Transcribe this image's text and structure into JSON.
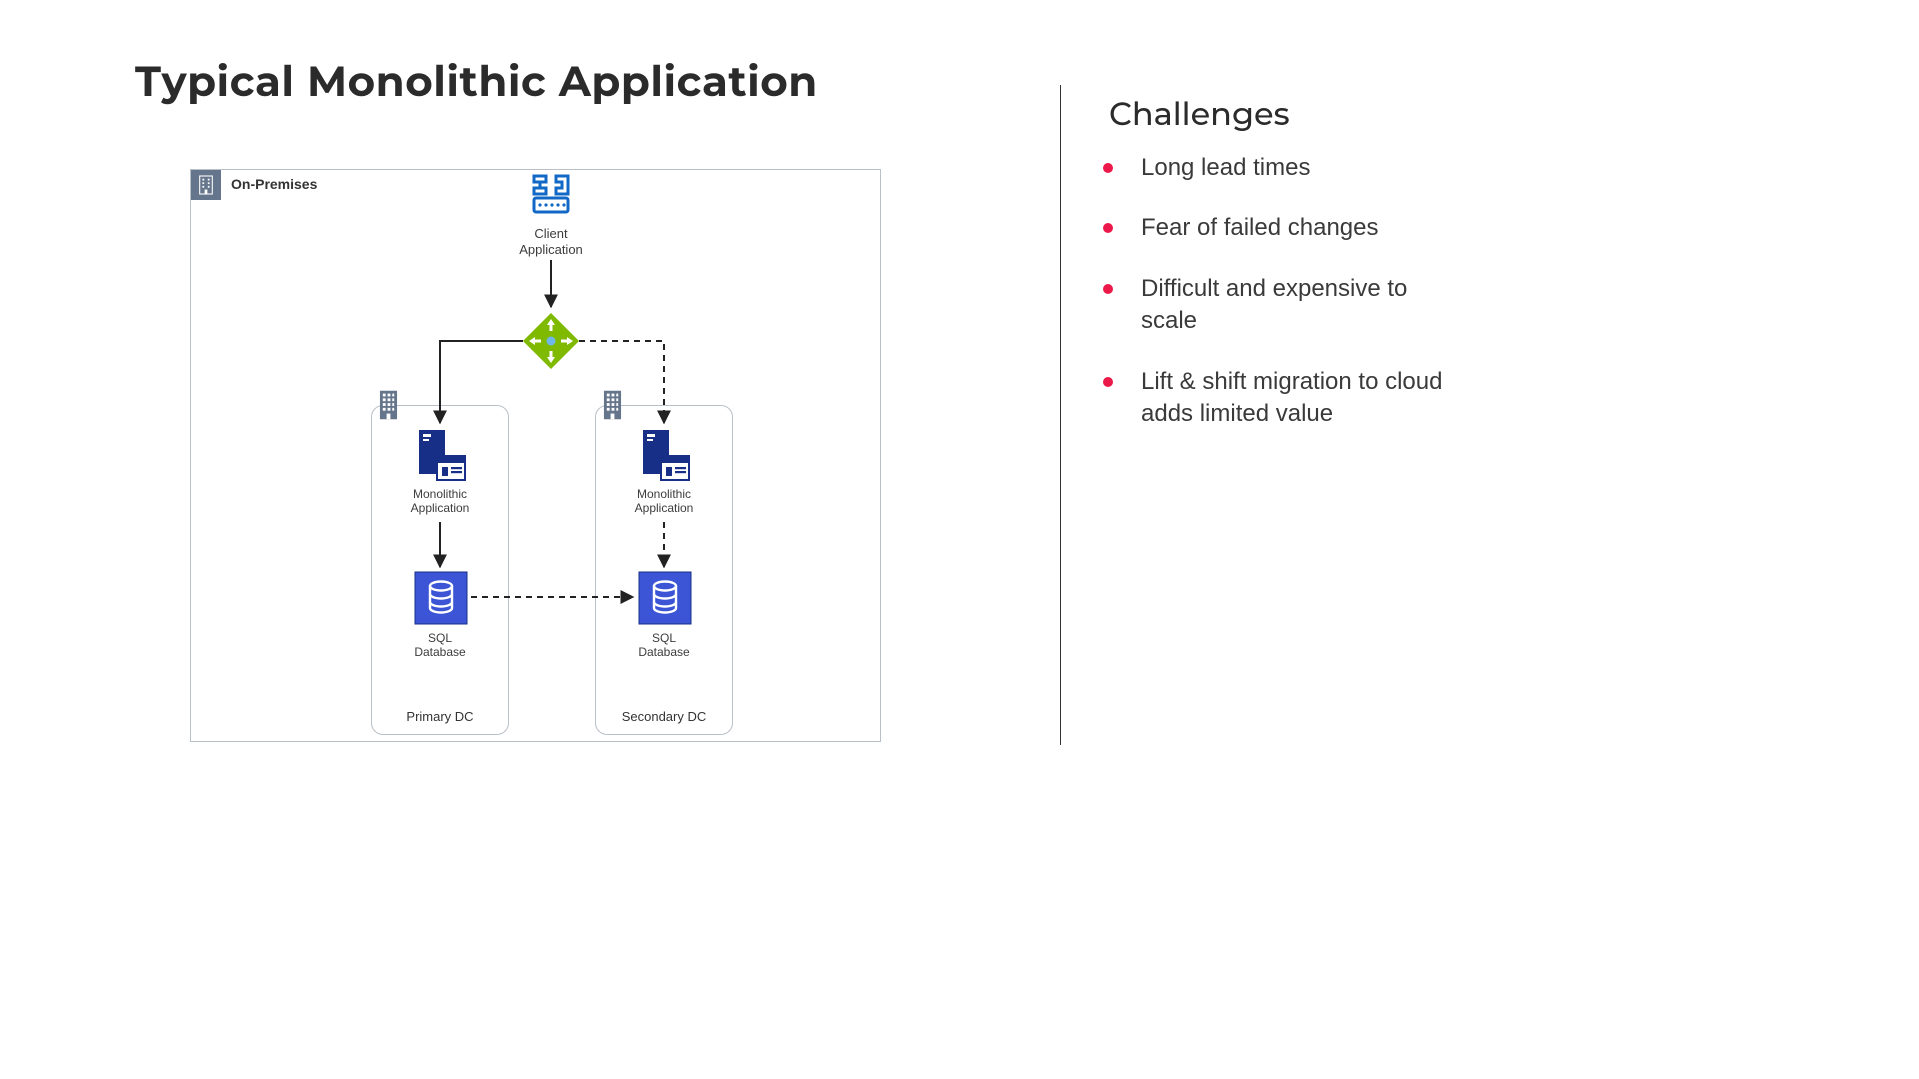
{
  "title": "Typical Monolithic Application",
  "sidebar": {
    "heading": "Challenges",
    "items": [
      "Long lead times",
      "Fear of failed changes",
      "Difficult and expensive to scale",
      "Lift & shift migration to cloud adds limited value"
    ]
  },
  "diagram": {
    "container_label": "On-Premises",
    "client_label": "Client\nApplication",
    "dc_primary": {
      "title": "Primary DC",
      "app_label": "Monolithic\nApplication",
      "db_label": "SQL\nDatabase"
    },
    "dc_secondary": {
      "title": "Secondary DC",
      "app_label": "Monolithic\nApplication",
      "db_label": "SQL\nDatabase"
    }
  },
  "colors": {
    "bullet": "#ec1849",
    "azure_blue": "#1168c6",
    "azure_dark": "#182f87",
    "router_green": "#7fba00",
    "grey": "#65758b"
  }
}
